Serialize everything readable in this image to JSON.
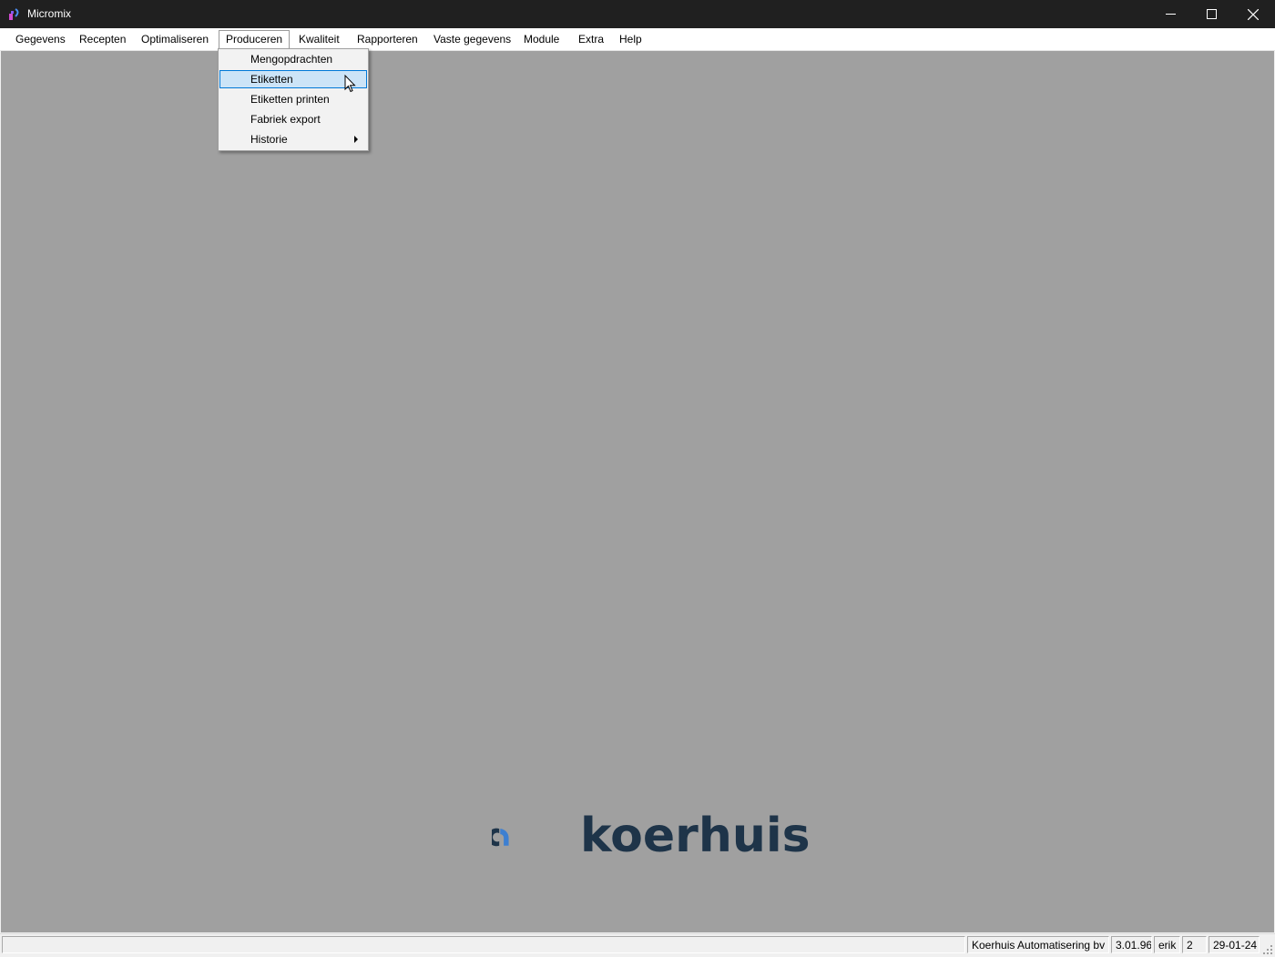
{
  "window": {
    "title": "Micromix",
    "controls": {
      "minimize": "minimize-icon",
      "maximize": "maximize-icon",
      "close": "close-icon"
    }
  },
  "menubar": {
    "items": [
      {
        "label": "Gegevens"
      },
      {
        "label": "Recepten"
      },
      {
        "label": "Optimaliseren"
      },
      {
        "label": "Produceren",
        "open": true
      },
      {
        "label": "Kwaliteit"
      },
      {
        "label": "Rapporteren"
      },
      {
        "label": "Vaste gegevens"
      },
      {
        "label": "Module"
      },
      {
        "label": "Extra"
      },
      {
        "label": "Help"
      }
    ]
  },
  "dropdown": {
    "parent": "Produceren",
    "items": [
      {
        "label": "Mengopdrachten"
      },
      {
        "label": "Etiketten",
        "highlighted": true
      },
      {
        "label": "Etiketten printen"
      },
      {
        "label": "Fabriek export"
      },
      {
        "label": "Historie",
        "submenu": true
      }
    ]
  },
  "background": {
    "logo_text": "koerhuis",
    "logo_colors": {
      "dark": "#1e3449",
      "accent": "#3d7fd1"
    }
  },
  "statusbar": {
    "company": "Koerhuis Automatisering bv",
    "version": "3.01.96",
    "user": "erik",
    "number": "2",
    "date": "29-01-24"
  },
  "colors": {
    "titlebar": "#202020",
    "client_area": "#a0a0a0",
    "menu_highlight": "#cce4f7",
    "menu_highlight_border": "#0078d7"
  }
}
